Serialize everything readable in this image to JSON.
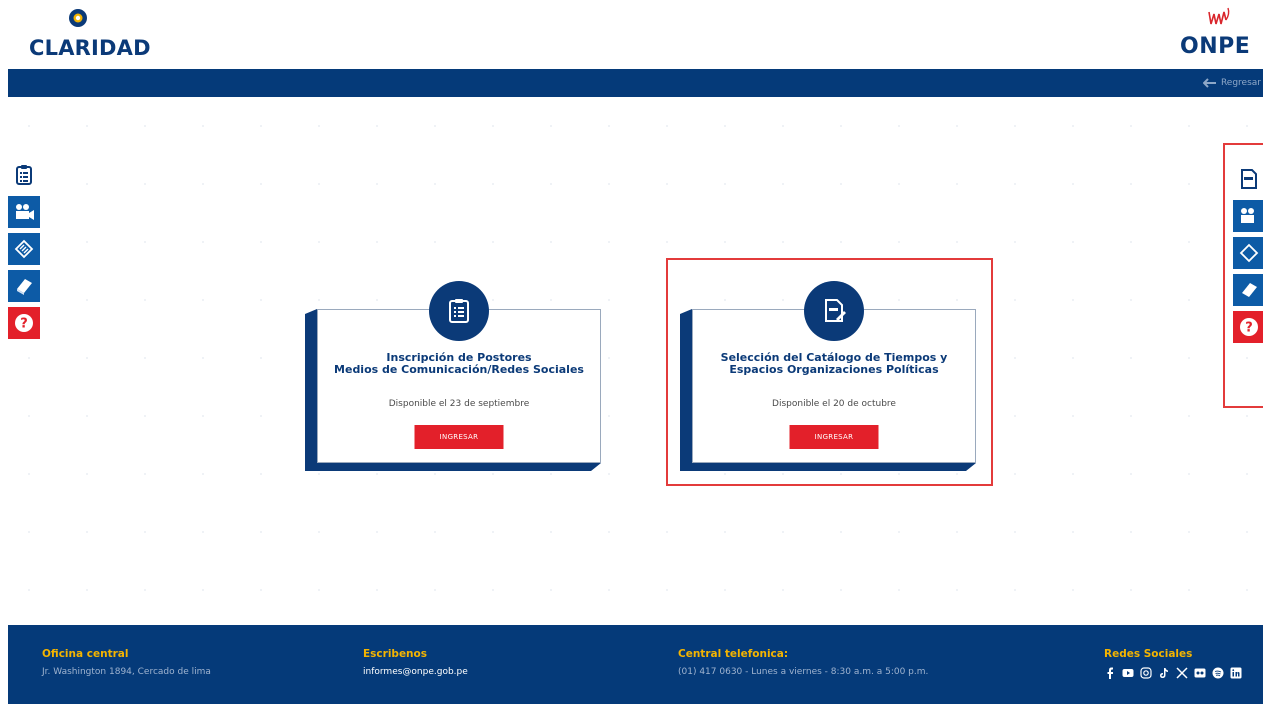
{
  "header": {
    "left_logo_text": "CLARIDAD",
    "right_logo_text": "ONPE"
  },
  "nav": {
    "back_label": "Regresar"
  },
  "cards": [
    {
      "title_line1": "Inscripción de Postores",
      "title_line2": "Medios de Comunicación/Redes Sociales",
      "availability": "Disponible el 23 de septiembre",
      "button_label": "INGRESAR",
      "icon": "clipboard-list-icon"
    },
    {
      "title_line1": "Selección del Catálogo de Tiempos y",
      "title_line2": "Espacios Organizaciones Políticas",
      "availability": "Disponible el 20 de octubre",
      "button_label": "INGRESAR",
      "icon": "onpe-document-edit-icon"
    }
  ],
  "sidebar_left": [
    "clipboard-icon",
    "video-camera-icon",
    "ticket-icon",
    "book-icon",
    "help-icon"
  ],
  "sidebar_right": [
    "onpe-document-icon",
    "video-camera-icon",
    "ticket-icon",
    "book-icon",
    "help-icon"
  ],
  "footer": {
    "office_heading": "Oficina central",
    "office_address": "Jr. Washington 1894, Cercado de lima",
    "email_heading": "Escribenos",
    "email": "informes@onpe.gob.pe",
    "phone_heading": "Central telefonica:",
    "phone": "(01) 417 0630 - Lunes a viernes - 8:30 a.m. a 5:00 p.m.",
    "social_heading": "Redes Sociales",
    "social_icons": [
      "facebook-icon",
      "youtube-icon",
      "instagram-icon",
      "tiktok-icon",
      "x-icon",
      "flickr-icon",
      "spotify-icon",
      "linkedin-icon"
    ]
  },
  "colors": {
    "primary": "#053a79",
    "accent_red": "#e3202a",
    "footer_heading": "#f4b400",
    "highlight_frame": "#e33b3b"
  }
}
